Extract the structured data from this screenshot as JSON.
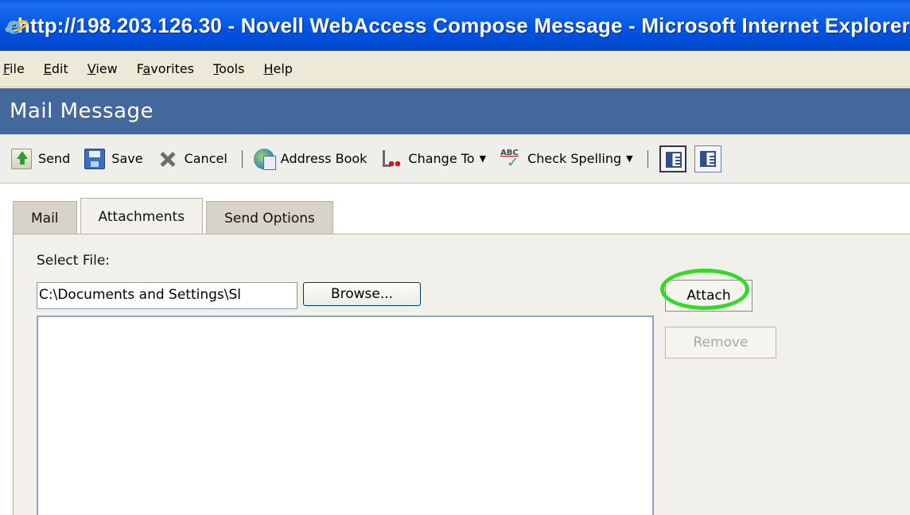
{
  "window": {
    "title": "http://198.203.126.30 - Novell WebAccess Compose Message - Microsoft Internet Explorer",
    "icon": "ie-icon"
  },
  "menubar": {
    "items": [
      {
        "label": "File",
        "mnemonic": "F"
      },
      {
        "label": "Edit",
        "mnemonic": "E"
      },
      {
        "label": "View",
        "mnemonic": "V"
      },
      {
        "label": "Favorites",
        "mnemonic": "a"
      },
      {
        "label": "Tools",
        "mnemonic": "T"
      },
      {
        "label": "Help",
        "mnemonic": "H"
      }
    ]
  },
  "header": {
    "title": "Mail Message",
    "color": "#42689c"
  },
  "toolbar": {
    "send_label": "Send",
    "save_label": "Save",
    "cancel_label": "Cancel",
    "address_book_label": "Address Book",
    "change_to_label": "Change To",
    "check_spelling_label": "Check Spelling"
  },
  "tabs": [
    {
      "label": "Mail",
      "active": false
    },
    {
      "label": "Attachments",
      "active": true
    },
    {
      "label": "Send Options",
      "active": false
    }
  ],
  "attachments": {
    "select_file_label": "Select File:",
    "file_value": "C:\\Documents and Settings\\Sl",
    "browse_label": "Browse...",
    "attach_label": "Attach",
    "remove_label": "Remove",
    "highlight_color": "#36d82a"
  }
}
